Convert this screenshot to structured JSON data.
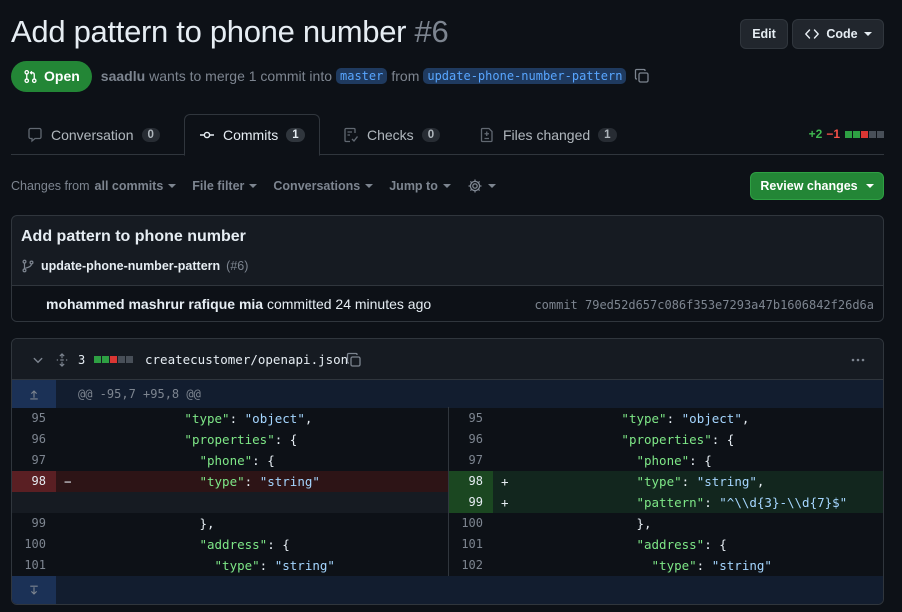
{
  "pr": {
    "title": "Add pattern to phone number",
    "number": "#6",
    "status": "Open",
    "author": "saadlu",
    "merge_text_1": "wants to merge 1 commit into",
    "base_branch": "master",
    "merge_text_2": "from",
    "head_branch": "update-phone-number-pattern"
  },
  "header_buttons": {
    "edit": "Edit",
    "code": "Code"
  },
  "tabs": [
    {
      "label": "Conversation",
      "count": "0",
      "icon": "comment-icon"
    },
    {
      "label": "Commits",
      "count": "1",
      "icon": "commit-icon"
    },
    {
      "label": "Checks",
      "count": "0",
      "icon": "checklist-icon"
    },
    {
      "label": "Files changed",
      "count": "1",
      "icon": "file-diff-icon"
    }
  ],
  "diffstat": {
    "additions": "+2",
    "deletions": "−1"
  },
  "toolbar": {
    "changes_prefix": "Changes from",
    "changes_value": "all commits",
    "file_filter": "File filter",
    "conversations": "Conversations",
    "jump_to": "Jump to",
    "review_button": "Review changes"
  },
  "commit": {
    "title": "Add pattern to phone number",
    "branch": "update-phone-number-pattern",
    "pr_ref": "(#6)",
    "author": "mohammed mashrur rafique mia",
    "action": "committed 24 minutes ago",
    "hash_label": "commit 79ed52d657c086f353e7293a47b1606842f26d6a"
  },
  "file": {
    "changes_count": "3",
    "path": "createcustomer/openapi.json",
    "hunk_header": "@@ -95,7 +95,8 @@"
  },
  "diff": {
    "left": [
      {
        "ln": "95",
        "sign": "",
        "key": "\"type\"",
        "rest": ": ",
        "val": "\"object\"",
        "tail": ",",
        "indent": "                "
      },
      {
        "ln": "96",
        "sign": "",
        "key": "\"properties\"",
        "rest": ": {",
        "val": "",
        "tail": "",
        "indent": "                "
      },
      {
        "ln": "97",
        "sign": "",
        "key": "\"phone\"",
        "rest": ": {",
        "val": "",
        "tail": "",
        "indent": "                  "
      },
      {
        "ln": "98",
        "sign": "−",
        "key": "\"type\"",
        "rest": ": ",
        "val": "\"string\"",
        "tail": "",
        "indent": "                  "
      },
      {
        "ln": "99",
        "sign": "",
        "key": "",
        "rest": "},",
        "val": "",
        "tail": "",
        "indent": "                  "
      },
      {
        "ln": "100",
        "sign": "",
        "key": "\"address\"",
        "rest": ": {",
        "val": "",
        "tail": "",
        "indent": "                  "
      },
      {
        "ln": "101",
        "sign": "",
        "key": "\"type\"",
        "rest": ": ",
        "val": "\"string\"",
        "tail": "",
        "indent": "                    "
      }
    ],
    "right": [
      {
        "ln": "95",
        "sign": "",
        "key": "\"type\"",
        "rest": ": ",
        "val": "\"object\"",
        "tail": ",",
        "indent": "                "
      },
      {
        "ln": "96",
        "sign": "",
        "key": "\"properties\"",
        "rest": ": {",
        "val": "",
        "tail": "",
        "indent": "                "
      },
      {
        "ln": "97",
        "sign": "",
        "key": "\"phone\"",
        "rest": ": {",
        "val": "",
        "tail": "",
        "indent": "                  "
      },
      {
        "ln": "98",
        "sign": "+",
        "key": "\"type\"",
        "rest": ": ",
        "val": "\"string\"",
        "tail": ",",
        "indent": "                  "
      },
      {
        "ln": "99",
        "sign": "+",
        "key": "\"pattern\"",
        "rest": ": ",
        "val": "\"^\\\\d{3}-\\\\d{7}$\"",
        "tail": "",
        "indent": "                  "
      },
      {
        "ln": "100",
        "sign": "",
        "key": "",
        "rest": "},",
        "val": "",
        "tail": "",
        "indent": "                  "
      },
      {
        "ln": "101",
        "sign": "",
        "key": "\"address\"",
        "rest": ": {",
        "val": "",
        "tail": "",
        "indent": "                  "
      },
      {
        "ln": "102",
        "sign": "",
        "key": "\"type\"",
        "rest": ": ",
        "val": "\"string\"",
        "tail": "",
        "indent": "                    "
      }
    ]
  },
  "colors": {
    "open_green": "#238636",
    "addition": "#3fb950",
    "deletion": "#f85149",
    "link": "#58a6ff"
  }
}
